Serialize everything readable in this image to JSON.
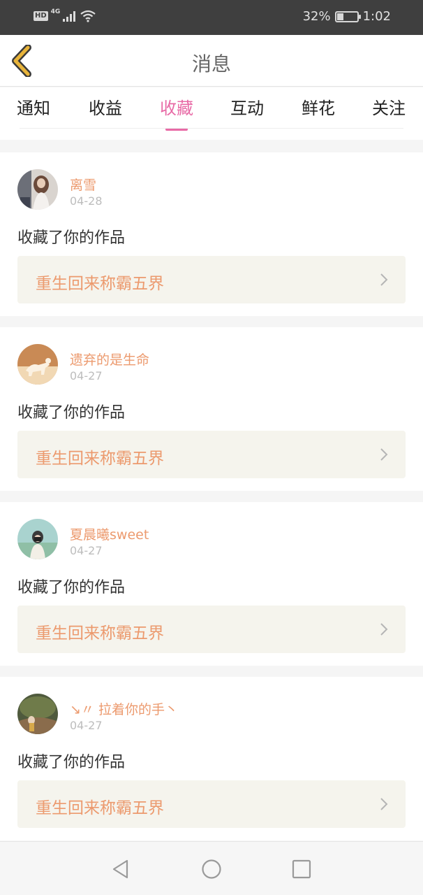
{
  "status_bar": {
    "hd": "HD",
    "network": "4G",
    "battery_text": "32%",
    "battery_level": 0.32,
    "time": "1:02"
  },
  "header": {
    "title": "消息",
    "back_icon": "back-chevron-icon"
  },
  "tabs": [
    {
      "label": "通知"
    },
    {
      "label": "收益"
    },
    {
      "label": "收藏",
      "active": true
    },
    {
      "label": "互动"
    },
    {
      "label": "鲜花"
    },
    {
      "label": "关注"
    }
  ],
  "notifications": [
    {
      "user": "离雪",
      "date": "04-28",
      "action": "收藏了你的作品",
      "work": "重生回来称霸五界"
    },
    {
      "user": "遗弃的是生命",
      "date": "04-27",
      "action": "收藏了你的作品",
      "work": "重生回来称霸五界"
    },
    {
      "user": "夏晨曦sweet",
      "date": "04-27",
      "action": "收藏了你的作品",
      "work": "重生回来称霸五界"
    },
    {
      "user": "↘〃 拉着你的手丶",
      "date": "04-27",
      "action": "收藏了你的作品",
      "work": "重生回来称霸五界"
    }
  ],
  "colors": {
    "accent": "#e86aa6",
    "username": "#ec9a6e",
    "back_icon": "#e8b43a"
  },
  "nav": {
    "back": "triangle-back-icon",
    "home": "circle-home-icon",
    "recents": "square-recents-icon"
  }
}
